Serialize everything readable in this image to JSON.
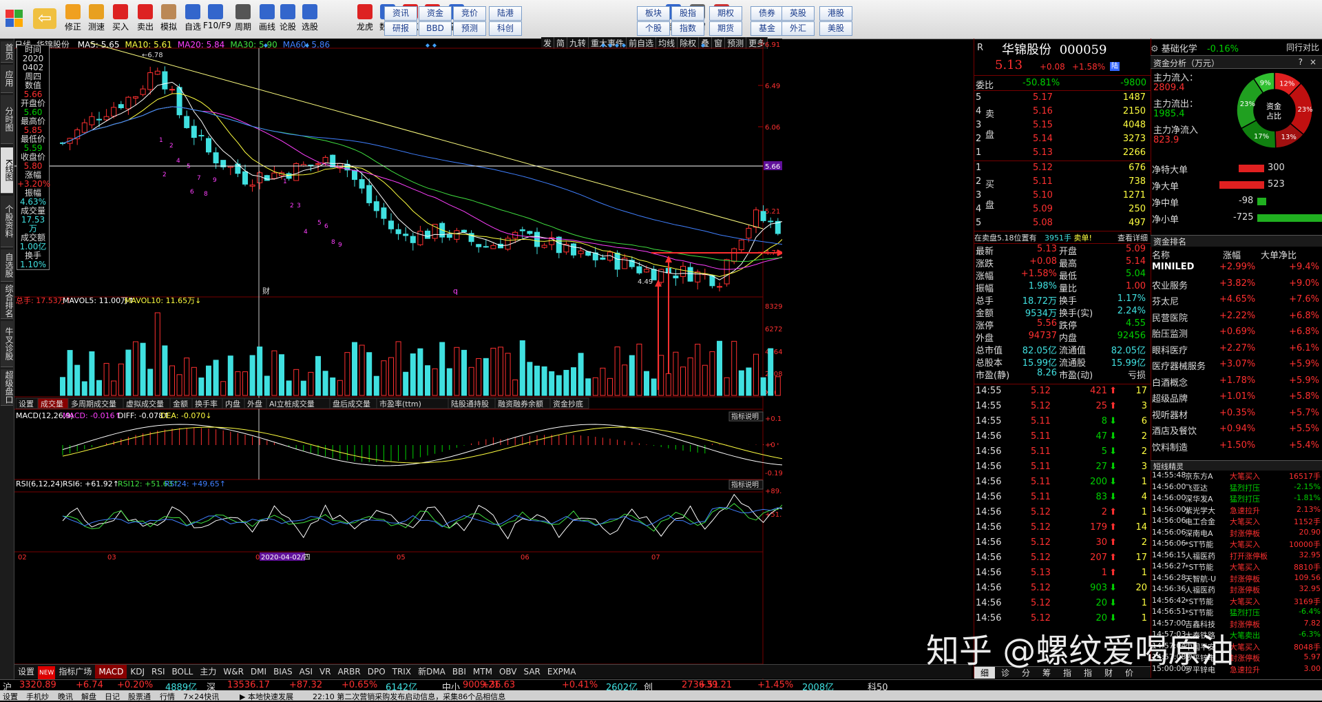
{
  "toolbar": {
    "buttons": [
      "修正",
      "测速",
      "买入",
      "卖出",
      "模拟",
      "自选",
      "F10/F9",
      "周期",
      "画线",
      "论股",
      "选股",
      "龙虎",
      "数据",
      "热点",
      "新股",
      "全球",
      "自定",
      "多窗",
      "默认"
    ],
    "grid_row1": [
      "资讯",
      "资金",
      "竞价",
      "陆港",
      "板块",
      "股指",
      "期权",
      "债券",
      "英股",
      "港股"
    ],
    "grid_row2": [
      "研报",
      "BBD",
      "预测",
      "科创",
      "个股",
      "指数",
      "期货",
      "基金",
      "外汇",
      "美股"
    ]
  },
  "left_tabs": [
    "首页",
    "应用",
    "分时图",
    "K线图",
    "个股资料",
    "自选股",
    "综合排名",
    "牛叉诊股",
    "超级盘口"
  ],
  "kline": {
    "period": "日线",
    "stock_name": "华锦股份",
    "ma_labels": [
      {
        "text": "MA5: 5.65",
        "color": "#ffffff"
      },
      {
        "text": "MA10: 5.61",
        "color": "#ffff40"
      },
      {
        "text": "MA20: 5.84",
        "color": "#ff40ff"
      },
      {
        "text": "MA30: 5.90",
        "color": "#40e040"
      },
      {
        "text": "MA60: 5.86",
        "color": "#4080ff"
      }
    ],
    "top_right_tabs": [
      "发",
      "简",
      "九转",
      "重大事件",
      "前自选",
      "均线",
      "除权",
      "叠",
      "窗",
      "预测",
      "更多"
    ],
    "price_axis": [
      "6.91",
      "6.49",
      "6.06",
      "5.66",
      "5.21",
      "4.79"
    ],
    "highlight_price": "5.66",
    "max_label": "6.78",
    "min_label": "4.49",
    "event_label": "财",
    "event_label2": "q",
    "info_box": [
      {
        "k": "时间",
        "v": "2020"
      },
      {
        "k": "",
        "v": "0402"
      },
      {
        "k": "",
        "v": "周四"
      },
      {
        "k": "数值",
        "v": "5.66",
        "c": "#ff3030"
      },
      {
        "k": "开盘价",
        "v": "5.60",
        "c": "#00d000"
      },
      {
        "k": "最高价",
        "v": "5.85",
        "c": "#ff3030"
      },
      {
        "k": "最低价",
        "v": "5.59",
        "c": "#00d000"
      },
      {
        "k": "收盘价",
        "v": "5.80",
        "c": "#ff3030"
      },
      {
        "k": "涨幅",
        "v": "+3.20%",
        "c": "#ff3030"
      },
      {
        "k": "振幅",
        "v": "4.63%",
        "c": "#40e0e0"
      },
      {
        "k": "成交量",
        "v": "17.53万",
        "c": "#40e0e0"
      },
      {
        "k": "成交额",
        "v": "1.00亿",
        "c": "#40e0e0"
      },
      {
        "k": "换手",
        "v": "1.10%",
        "c": "#40e0e0"
      }
    ]
  },
  "volume": {
    "header": [
      {
        "text": "总手: 17.53万↑",
        "color": "#ff3030"
      },
      {
        "text": "MAVOL5: 11.00万↑",
        "color": "#ffffff"
      },
      {
        "text": "MAVOL10: 11.65万↓",
        "color": "#ffff40"
      }
    ],
    "axis": [
      "83294",
      "62727",
      "41647",
      "21081",
      "X10"
    ],
    "tabs": [
      "设置",
      "成交量",
      "多周期成交量",
      "虚拟成交量",
      "金额",
      "换手率",
      "内盘",
      "外盘",
      "AI立桩成交量",
      "盘后成交量",
      "市盈率(ttm)",
      "陆股通持股",
      "融资融券余额",
      "资金抄底"
    ]
  },
  "macd": {
    "header": [
      {
        "text": "MACD(12,26,9)",
        "color": "#ffffff"
      },
      {
        "text": "MACD: -0.016↑",
        "color": "#ff40ff"
      },
      {
        "text": "DIFF: -0.078↑",
        "color": "#ffffff"
      },
      {
        "text": "DEA: -0.070↓",
        "color": "#ffff40"
      }
    ],
    "axis": [
      "+0.168",
      "+0",
      "-0.197"
    ],
    "explain": "指标说明"
  },
  "rsi": {
    "header": [
      {
        "text": "RSI(6,12,24)",
        "color": "#ffffff"
      },
      {
        "text": "RSI6: +61.92↑",
        "color": "#ffffff"
      },
      {
        "text": "RSI12: +51.63↑",
        "color": "#40e040"
      },
      {
        "text": "RSI24: +49.65↑",
        "color": "#4080ff"
      }
    ],
    "axis": [
      "+89.35",
      "+51.52"
    ],
    "explain": "指标说明"
  },
  "date_axis": [
    "02",
    "03",
    "04",
    "05",
    "06",
    "07"
  ],
  "date_marker": "2020-04-02/四",
  "bottom_tabs": [
    "设置",
    "NEW",
    "指标广场",
    "MACD",
    "KDJ",
    "RSI",
    "BOLL",
    "主力",
    "W&R",
    "DMI",
    "BIAS",
    "ASI",
    "VR",
    "ARBR",
    "DPO",
    "TRIX",
    "新DMA",
    "BBI",
    "MTM",
    "OBV",
    "SAR",
    "EXPMA"
  ],
  "quote": {
    "name": "华锦股份",
    "code": "000059",
    "price": "5.13",
    "change": "+0.08",
    "pct": "+1.58%",
    "weibi_label": "委比",
    "weibi": "-50.81%",
    "weicha": "-9800",
    "sell_label": "卖盘",
    "buy_label": "买盘",
    "sells": [
      [
        "5",
        "5.17",
        "1487"
      ],
      [
        "4",
        "5.16",
        "2150"
      ],
      [
        "3",
        "5.15",
        "4048"
      ],
      [
        "2",
        "5.14",
        "3273"
      ],
      [
        "1",
        "5.13",
        "2266"
      ]
    ],
    "buys": [
      [
        "1",
        "5.12",
        "676"
      ],
      [
        "2",
        "5.11",
        "738"
      ],
      [
        "3",
        "5.10",
        "1271"
      ],
      [
        "4",
        "5.09",
        "250"
      ],
      [
        "5",
        "5.08",
        "497"
      ]
    ],
    "pending": "在卖盘5.18位置有",
    "pending_vol": "3951手",
    "pending_tag": "卖单!",
    "detail": "查看详细",
    "stats": [
      [
        "最新",
        "5.13",
        "开盘",
        "5.09"
      ],
      [
        "涨跌",
        "+0.08",
        "最高",
        "5.14"
      ],
      [
        "涨幅",
        "+1.58%",
        "最低",
        "5.04"
      ],
      [
        "振幅",
        "1.98%",
        "量比",
        "1.00"
      ],
      [
        "总手",
        "18.72万",
        "换手",
        "1.17%"
      ],
      [
        "金额",
        "9534万",
        "换手(实)",
        "2.24%"
      ],
      [
        "涨停",
        "5.56",
        "跌停",
        "4.55"
      ],
      [
        "外盘",
        "94737",
        "内盘",
        "92456"
      ],
      [
        "总市值",
        "82.05亿",
        "流通值",
        "82.05亿"
      ],
      [
        "总股本",
        "15.99亿",
        "流通股",
        "15.99亿"
      ],
      [
        "市盈(静)",
        "8.26",
        "市盈(动)",
        "亏损"
      ]
    ],
    "ticks": [
      [
        "14:55",
        "5.12",
        "421",
        "up",
        "17"
      ],
      [
        "14:55",
        "5.12",
        "25",
        "up",
        "3"
      ],
      [
        "14:55",
        "5.11",
        "8",
        "dn",
        "6"
      ],
      [
        "14:56",
        "5.11",
        "47",
        "dn",
        "2"
      ],
      [
        "14:56",
        "5.11",
        "5",
        "dn",
        "2"
      ],
      [
        "14:56",
        "5.11",
        "27",
        "dn",
        "3"
      ],
      [
        "14:56",
        "5.11",
        "200",
        "dn",
        "1"
      ],
      [
        "14:56",
        "5.11",
        "83",
        "dn",
        "4"
      ],
      [
        "14:56",
        "5.12",
        "2",
        "up",
        "1"
      ],
      [
        "14:56",
        "5.12",
        "179",
        "up",
        "14"
      ],
      [
        "14:56",
        "5.12",
        "30",
        "up",
        "2"
      ],
      [
        "14:56",
        "5.12",
        "207",
        "up",
        "17"
      ],
      [
        "14:56",
        "5.13",
        "1",
        "up",
        "1"
      ],
      [
        "14:56",
        "5.12",
        "903",
        "dn",
        "20"
      ],
      [
        "14:56",
        "5.12",
        "20",
        "dn",
        "1"
      ],
      [
        "14:56",
        "5.12",
        "20",
        "dn",
        "1"
      ]
    ],
    "bottom_tabs": [
      "细",
      "诊",
      "分",
      "筹",
      "指",
      "指",
      "财",
      "价"
    ]
  },
  "side": {
    "sector": "基础化学",
    "sector_pct": "-0.16%",
    "same_industry": "同行对比",
    "fund_title": "资金分析（万元）",
    "fund_help": "?",
    "fund_close": "×",
    "inflow_label": "主力流入：",
    "inflow": "2809.4",
    "outflow_label": "主力流出：",
    "outflow": "1985.4",
    "net_label": "主力净流入",
    "net": "823.9",
    "pie_center": "资金占比",
    "pie": [
      {
        "label": "12%",
        "value": 12,
        "color": "#e02020"
      },
      {
        "label": "23%",
        "value": 23,
        "color": "#c01010"
      },
      {
        "label": "13%",
        "value": 13,
        "color": "#a01010"
      },
      {
        "label": "17%",
        "value": 17,
        "color": "#108010"
      },
      {
        "label": "23%",
        "value": 23,
        "color": "#20a020"
      },
      {
        "label": "9%",
        "value": 9,
        "color": "#30c030"
      }
    ],
    "bars": [
      {
        "label": "净特大单",
        "value": "300",
        "num": 300,
        "color": "#e02020"
      },
      {
        "label": "净大单",
        "value": "523",
        "num": 523,
        "color": "#e02020"
      },
      {
        "label": "净中单",
        "value": "-98",
        "num": -98,
        "color": "#20b020"
      },
      {
        "label": "净小单",
        "value": "-725",
        "num": -725,
        "color": "#20b020"
      }
    ],
    "rank_title": "资金排名",
    "rank_headers": [
      "名称",
      "涨幅",
      "大单净比"
    ],
    "ranks": [
      [
        "MINILED",
        "+2.99%",
        "+9.4%"
      ],
      [
        "农业服务",
        "+3.82%",
        "+9.0%"
      ],
      [
        "芬太尼",
        "+4.65%",
        "+7.6%"
      ],
      [
        "民营医院",
        "+2.22%",
        "+6.8%"
      ],
      [
        "胎压监测",
        "+0.69%",
        "+6.8%"
      ],
      [
        "眼科医疗",
        "+2.27%",
        "+6.1%"
      ],
      [
        "医疗器械服务",
        "+3.07%",
        "+5.9%"
      ],
      [
        "白酒概念",
        "+1.78%",
        "+5.9%"
      ],
      [
        "超级品牌",
        "+1.01%",
        "+5.8%"
      ],
      [
        "视听器材",
        "+0.35%",
        "+5.7%"
      ],
      [
        "酒店及餐饮",
        "+0.94%",
        "+5.5%"
      ],
      [
        "饮料制造",
        "+1.50%",
        "+5.4%"
      ]
    ],
    "short_title": "短线精灵",
    "shorts": [
      [
        "14:55:48",
        "京东方A",
        "大笔买入",
        "16517手"
      ],
      [
        "14:56:00",
        "飞亚达",
        "猛烈打压",
        "-2.15%"
      ],
      [
        "14:56:00",
        "深华发A",
        "猛烈打压",
        "-1.81%"
      ],
      [
        "14:56:00",
        "紫光学大",
        "急速拉升",
        "2.13%"
      ],
      [
        "14:56:06",
        "电工合金",
        "大笔买入",
        "1152手"
      ],
      [
        "14:56:06",
        "深南电A",
        "封涨停板",
        "20.90"
      ],
      [
        "14:56:06",
        "*ST节能",
        "大笔买入",
        "10000手"
      ],
      [
        "14:56:15",
        "人福医药",
        "打开涨停板",
        "32.95"
      ],
      [
        "14:56:27",
        "*ST节能",
        "大笔买入",
        "8810手"
      ],
      [
        "14:56:28",
        "天智航-U",
        "封涨停板",
        "109.56"
      ],
      [
        "14:56:36",
        "人福医药",
        "封涨停板",
        "32.95"
      ],
      [
        "14:56:42",
        "*ST节能",
        "大笔买入",
        "3169手"
      ],
      [
        "14:56:51",
        "*ST节能",
        "猛烈打压",
        "-6.4%"
      ],
      [
        "14:57:00",
        "吉鑫科技",
        "封涨停板",
        "7.82"
      ],
      [
        "14:57:03",
        "大秦铁路",
        "大笔卖出",
        "-6.3%"
      ],
      [
        "14:57:04",
        "中国平安",
        "大笔买入",
        "8048手"
      ],
      [
        "14:57:08",
        "罗平锌电",
        "封涨停板",
        "5.97"
      ],
      [
        "15:00:00",
        "罗平锌电",
        "急速拉升",
        "3.00"
      ]
    ]
  },
  "status": [
    {
      "text": "沪",
      "c": "#e0e0e0"
    },
    {
      "text": "3320.89",
      "c": "#ff3030"
    },
    {
      "text": "+6.74",
      "c": "#ff3030"
    },
    {
      "text": "+0.20%",
      "c": "#ff3030"
    },
    {
      "text": "4889亿",
      "c": "#40e0e0"
    },
    {
      "text": "深",
      "c": "#e0e0e0"
    },
    {
      "text": "13536.17",
      "c": "#ff3030"
    },
    {
      "text": "+87.32",
      "c": "#ff3030"
    },
    {
      "text": "+0.65%",
      "c": "#ff3030"
    },
    {
      "text": "6142亿",
      "c": "#40e0e0"
    },
    {
      "text": "中小",
      "c": "#e0e0e0"
    },
    {
      "text": "9009.21",
      "c": "#ff3030"
    },
    {
      "text": "+36.63",
      "c": "#ff3030"
    },
    {
      "text": "+0.41%",
      "c": "#ff3030"
    },
    {
      "text": "2602亿",
      "c": "#40e0e0"
    },
    {
      "text": "创",
      "c": "#e0e0e0"
    },
    {
      "text": "2736.51",
      "c": "#ff3030"
    },
    {
      "text": "+39.21",
      "c": "#ff3030"
    },
    {
      "text": "+1.45%",
      "c": "#ff3030"
    },
    {
      "text": "2008亿",
      "c": "#40e0e0"
    },
    {
      "text": "科50",
      "c": "#e0e0e0"
    }
  ],
  "ticker": [
    "设置",
    "手机炒",
    "晚讯",
    "解盘",
    "日记",
    "股票通",
    "行情",
    "7×24快讯",
    "▶ 本地快速发展",
    "22:10 第二次营销采购发布启动信息，采集86个品相信息"
  ],
  "watermark": "知乎 @螺纹爱喝原油"
}
